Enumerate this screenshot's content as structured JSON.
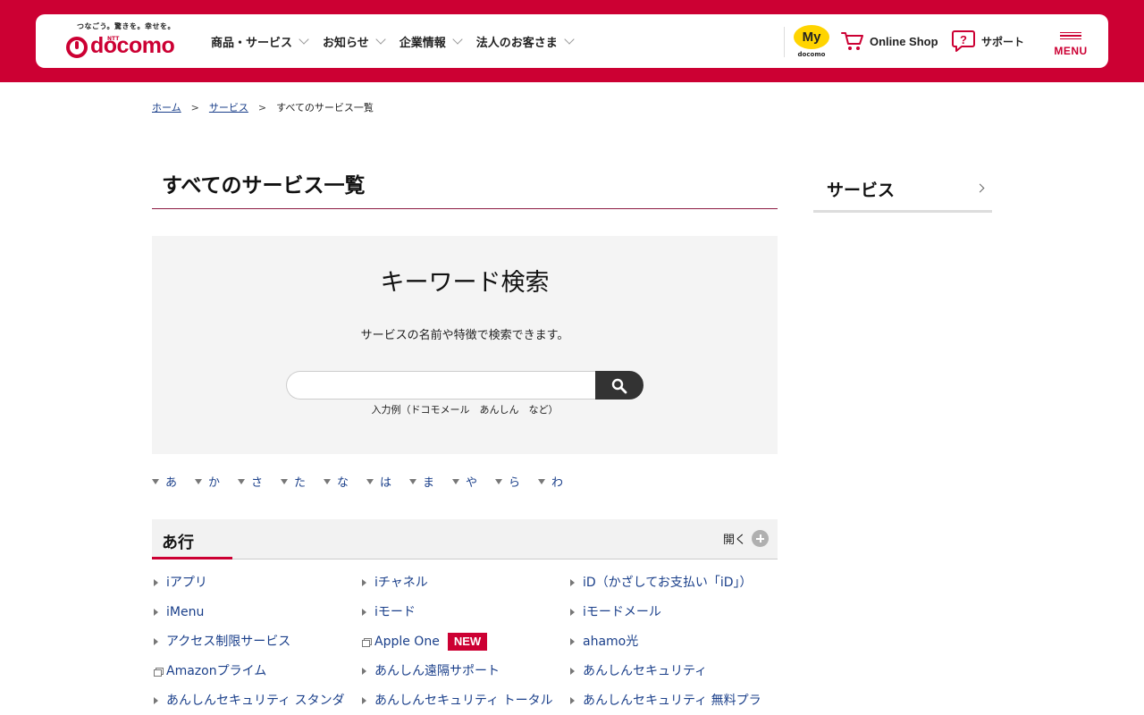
{
  "colors": {
    "brand_red": "#cc0033",
    "link_blue": "#1a3f8a",
    "my_yellow": "#ffd400",
    "panel_gray": "#f4f4f4"
  },
  "header": {
    "logo": {
      "tagline": "つなごう。驚きを。幸せを。",
      "ntt": "NTT",
      "wordmark": "docomo"
    },
    "nav": [
      {
        "label": "商品・サービス"
      },
      {
        "label": "お知らせ"
      },
      {
        "label": "企業情報"
      },
      {
        "label": "法人のお客さま"
      }
    ],
    "my_docomo": {
      "label": "My",
      "sub": "docomo"
    },
    "online_shop": {
      "label": "Online Shop",
      "icon": "cart-icon"
    },
    "support": {
      "label": "サポート",
      "icon": "question-bubble-icon"
    },
    "menu": {
      "label": "MENU",
      "icon": "hamburger-icon"
    }
  },
  "breadcrumb": {
    "home": "ホーム",
    "services": "サービス",
    "current": "すべてのサービス一覧",
    "separator": ">"
  },
  "page": {
    "title": "すべてのサービス一覧"
  },
  "sidebar": {
    "title": "サービス"
  },
  "search": {
    "title": "キーワード検索",
    "description": "サービスの名前や特徴で検索できます。",
    "input_value": "",
    "example": "入力例（ドコモメール　あんしん　など）",
    "icon": "search-icon"
  },
  "kana_nav": [
    "あ",
    "か",
    "さ",
    "た",
    "な",
    "は",
    "ま",
    "や",
    "ら",
    "わ"
  ],
  "section": {
    "title": "あ行",
    "toggle_label": "開く"
  },
  "services": [
    {
      "label": "iアプリ",
      "external": false
    },
    {
      "label": "iチャネル",
      "external": false
    },
    {
      "label": "iD（かざしてお支払い「iD」）",
      "external": false
    },
    {
      "label": "iMenu",
      "external": false
    },
    {
      "label": "iモード",
      "external": false
    },
    {
      "label": "iモードメール",
      "external": false
    },
    {
      "label": "アクセス制限サービス",
      "external": false
    },
    {
      "label": "Apple One",
      "external": true,
      "badge": "NEW"
    },
    {
      "label": "ahamo光",
      "external": false
    },
    {
      "label": "Amazonプライム",
      "external": true
    },
    {
      "label": "あんしん遠隔サポート",
      "external": false
    },
    {
      "label": "あんしんセキュリティ",
      "external": false
    },
    {
      "label": "あんしんセキュリティ スタンダ",
      "external": false
    },
    {
      "label": "あんしんセキュリティ トータル",
      "external": false
    },
    {
      "label": "あんしんセキュリティ 無料プラ",
      "external": false
    }
  ]
}
